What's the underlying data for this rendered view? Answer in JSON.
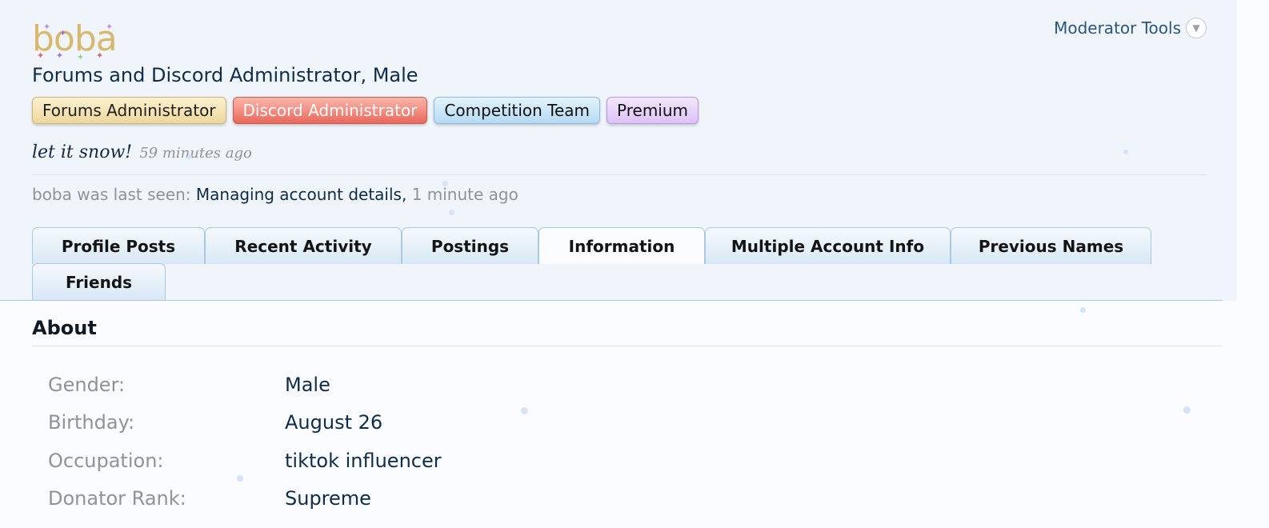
{
  "profile": {
    "logo_text": "boba",
    "user_title": "Forums and Discord Administrator, Male",
    "banners": [
      "Forums Administrator",
      "Discord Administrator",
      "Competition Team",
      "Premium"
    ],
    "status": {
      "message": "let it snow!",
      "time": "59 minutes ago"
    },
    "last_seen": {
      "prefix": "boba was last seen:",
      "activity": "Managing account details,",
      "time": "1 minute ago"
    }
  },
  "moderator_tools": {
    "label": "Moderator Tools",
    "icon": "chevron-down-circle-icon"
  },
  "tabs": [
    {
      "label": "Profile Posts",
      "active": false
    },
    {
      "label": "Recent Activity",
      "active": false
    },
    {
      "label": "Postings",
      "active": false
    },
    {
      "label": "Information",
      "active": true
    },
    {
      "label": "Multiple Account Info",
      "active": false
    },
    {
      "label": "Previous Names",
      "active": false
    },
    {
      "label": "Friends",
      "active": false
    }
  ],
  "about": {
    "title": "About",
    "rows": [
      {
        "label": "Gender:",
        "value": "Male"
      },
      {
        "label": "Birthday:",
        "value": "August 26"
      },
      {
        "label": "Occupation:",
        "value": "tiktok influencer"
      },
      {
        "label": "Donator Rank:",
        "value": "Supreme"
      }
    ]
  },
  "colors": {
    "header_bg": "#f0f5fb",
    "page_bg": "#fbfcff",
    "tab_border": "#a9c8e3",
    "link": "#2a557f",
    "muted": "#8d939b",
    "logo": "#d8b86c"
  }
}
